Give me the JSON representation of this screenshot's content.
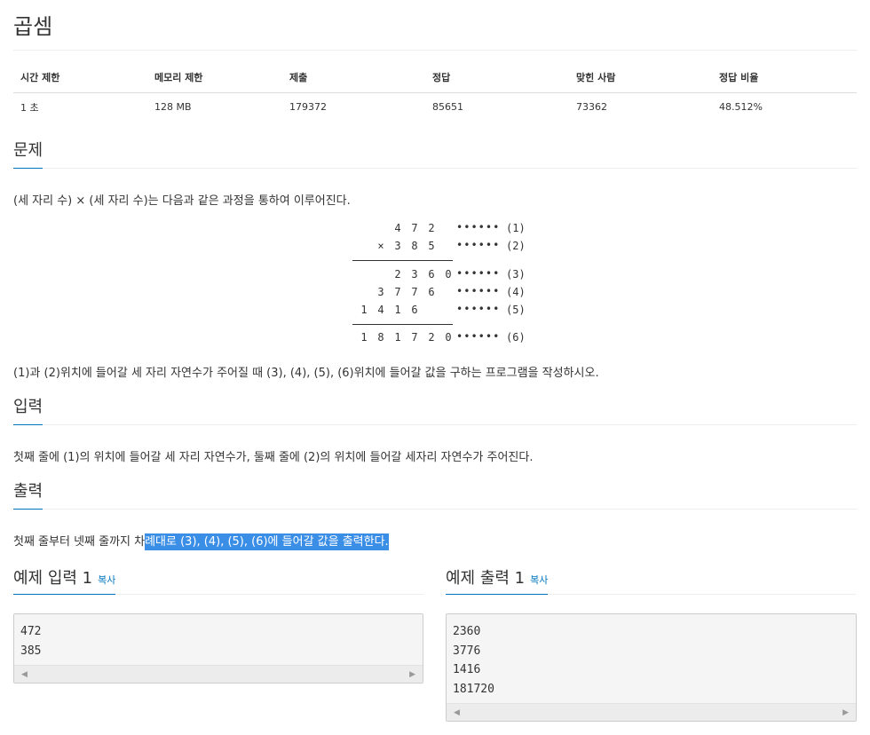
{
  "problem": {
    "title": "곱셈"
  },
  "stats": {
    "headers": [
      "시간 제한",
      "메모리 제한",
      "제출",
      "정답",
      "맞힌 사람",
      "정답 비율"
    ],
    "values": [
      "1 초",
      "128 MB",
      "179372",
      "85651",
      "73362",
      "48.512%"
    ]
  },
  "sections": {
    "problem_label": "문제",
    "input_label": "입력",
    "output_label": "출력"
  },
  "description": {
    "intro": "(세 자리 수) × (세 자리 수)는 다음과 같은 과정을 통하여 이루어진다.",
    "question": "(1)과 (2)위치에 들어갈 세 자리 자연수가 주어질 때 (3), (4), (5), (6)위치에 들어갈 값을 구하는 프로그램을 작성하시오."
  },
  "multiplication": {
    "rows": [
      {
        "digits": [
          "",
          "",
          "4",
          "7",
          "2"
        ],
        "dots": "••••••",
        "tag": "(1)"
      },
      {
        "digits": [
          "",
          "×",
          "3",
          "8",
          "5"
        ],
        "dots": "••••••",
        "tag": "(2)"
      },
      {
        "digits": [
          "",
          "",
          "2",
          "3",
          "6",
          "0"
        ],
        "dots": "••••••",
        "tag": "(3)"
      },
      {
        "digits": [
          "",
          "3",
          "7",
          "7",
          "6"
        ],
        "dots": "••••••",
        "tag": "(4)"
      },
      {
        "digits": [
          "1",
          "4",
          "1",
          "6"
        ],
        "dots": "••••••",
        "tag": "(5)"
      },
      {
        "digits": [
          "1",
          "8",
          "1",
          "7",
          "2",
          "0"
        ],
        "dots": "••••••",
        "tag": "(6)"
      }
    ]
  },
  "input_text": "첫째 줄에 (1)의 위치에 들어갈 세 자리 자연수가, 둘째 줄에 (2)의 위치에 들어갈 세자리 자연수가 주어진다.",
  "output_text": {
    "plain": "첫째 줄부터 넷째 줄까지 차",
    "selected": "례대로 (3), (4), (5), (6)에 들어갈 값을 출력한다."
  },
  "samples": {
    "input": {
      "label": "예제 입력 1",
      "copy": "복사",
      "content": "472\n385"
    },
    "output": {
      "label": "예제 출력 1",
      "copy": "복사",
      "content": "2360\n3776\n1416\n181720"
    }
  }
}
